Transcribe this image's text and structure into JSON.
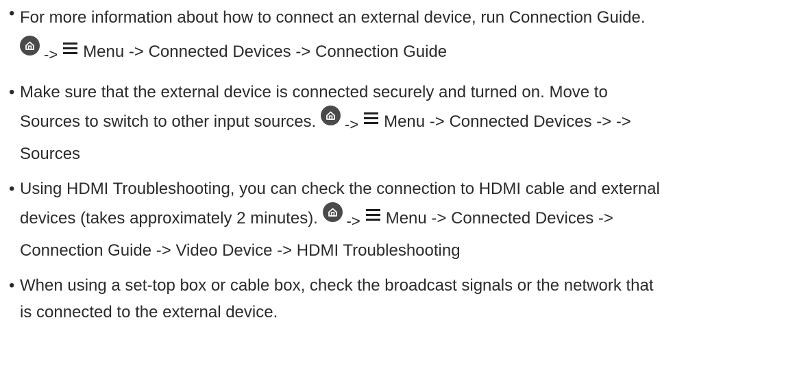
{
  "items": [
    {
      "text_a": "For more information about how to connect an external device, run Connection Guide.",
      "arrow": "->",
      "path": "Menu -> Connected Devices -> Connection Guide"
    },
    {
      "text_a": "Make sure that the external device is connected securely and turned on. Move to",
      "text_b": "Sources to switch to other input sources.",
      "arrow": "->",
      "path": "Menu -> Connected Devices -> ->",
      "text_c": "Sources"
    },
    {
      "text_a": "Using HDMI Troubleshooting, you can check the connection to HDMI cable and external",
      "text_b": "devices (takes approximately 2 minutes).",
      "arrow": "->",
      "path": "Menu -> Connected Devices ->",
      "text_c": "Connection Guide -> Video Device -> HDMI Troubleshooting"
    },
    {
      "text_a": "When using a set-top box or cable box, check the broadcast signals or the network that",
      "text_b": "is connected to the external device."
    }
  ],
  "bullet": "•",
  "icons": {
    "home": "home-icon",
    "menu": "menu-icon"
  },
  "colors": {
    "text": "#2b2b2b",
    "icon": "#4a4a4a"
  }
}
